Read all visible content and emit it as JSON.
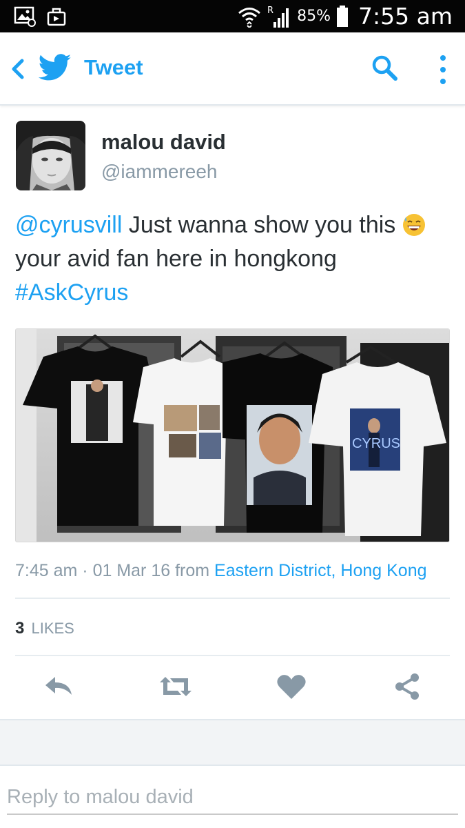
{
  "status_bar": {
    "battery": "85%",
    "time": "7:55 am",
    "icons": [
      "gallery-notification-icon",
      "download-notification-icon",
      "wifi-icon",
      "signal-icon",
      "battery-icon"
    ]
  },
  "app_bar": {
    "title": "Tweet",
    "icons": [
      "back-chevron-icon",
      "twitter-bird-icon",
      "search-icon",
      "more-vert-icon"
    ],
    "accent_color": "#1da1f2"
  },
  "tweet": {
    "display_name": "malou david",
    "handle": "@iammereeh",
    "mention": "@cyrusvill",
    "text_part1": " Just wanna show you this ",
    "emoji": "😅",
    "text_part2": "your avid fan here in hongkong ",
    "hashtag": "#AskCyrus",
    "media_shirt_print_text": "CYRUS",
    "time": "7:45 am",
    "separator": " · ",
    "date": "01 Mar 16",
    "from_label": " from ",
    "location": "Eastern District, Hong Kong",
    "likes_count": "3",
    "likes_label": "LIKES"
  },
  "actions": [
    "reply-icon",
    "retweet-icon",
    "like-icon",
    "share-icon"
  ],
  "reply": {
    "placeholder": "Reply to malou david"
  }
}
